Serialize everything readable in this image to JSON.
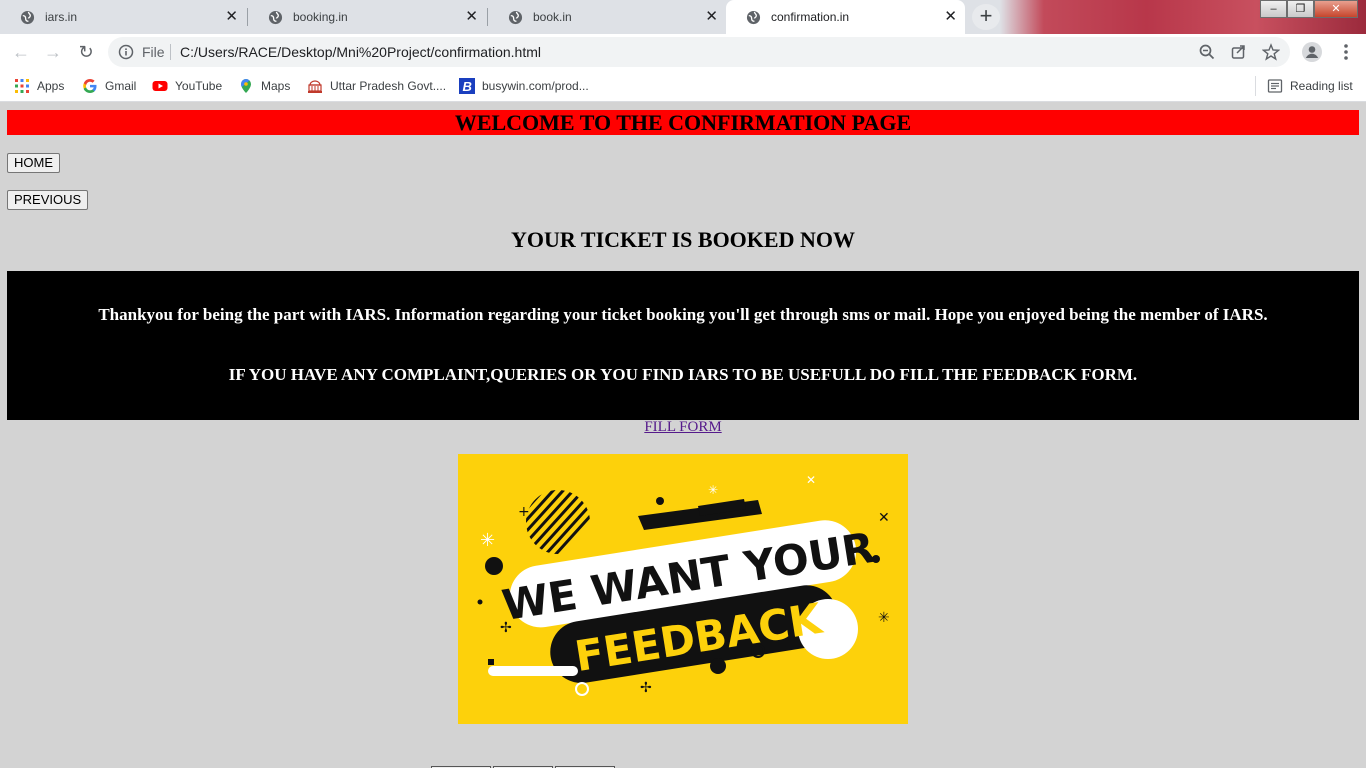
{
  "tabs": [
    {
      "title": "iars.in",
      "active": false
    },
    {
      "title": "booking.in",
      "active": false
    },
    {
      "title": "book.in",
      "active": false
    },
    {
      "title": "confirmation.in",
      "active": true
    }
  ],
  "toolbar": {
    "scheme_label": "File",
    "url": "C:/Users/RACE/Desktop/Mni%20Project/confirmation.html"
  },
  "bookmarks": [
    {
      "label": "Apps",
      "icon": "apps-grid-icon"
    },
    {
      "label": "Gmail",
      "icon": "google-icon"
    },
    {
      "label": "YouTube",
      "icon": "youtube-icon"
    },
    {
      "label": "Maps",
      "icon": "maps-pin-icon"
    },
    {
      "label": "Uttar Pradesh Govt....",
      "icon": "govt-building-icon"
    },
    {
      "label": "busywin.com/prod...",
      "icon": "busy-b-icon"
    }
  ],
  "reading_list": "Reading list",
  "page": {
    "welcome": "WELCOME TO THE CONFIRMATION PAGE",
    "home_button": "HOME",
    "previous_button": "PREVIOUS",
    "booked_heading": "YOUR TICKET IS BOOKED NOW",
    "thank_you": "Thankyou for being the part with IARS. Information regarding your ticket booking you'll get through sms or mail. Hope you enjoyed being the member of IARS.",
    "complaint": "IF YOU HAVE ANY COMPLAINT,QUERIES OR YOU FIND IARS TO BE USEFULL DO FILL THE FEEDBACK FORM.",
    "fill_form_link": "FILL FORM",
    "banner_line1": "WE WANT YOUR",
    "banner_line2": "FEEDBACK"
  },
  "colors": {
    "page_bg": "#d3d3d3",
    "welcome_bg": "#ff0000",
    "message_bg": "#000000",
    "banner_bg": "#fdd10b",
    "link": "#551a8b"
  }
}
